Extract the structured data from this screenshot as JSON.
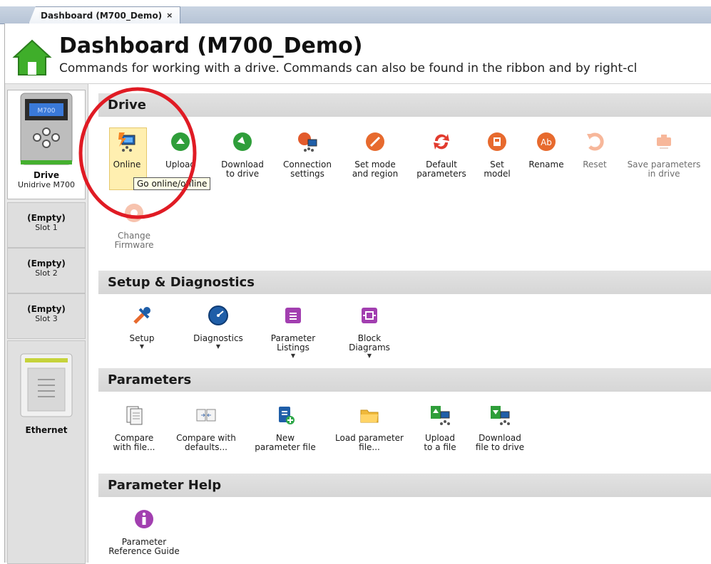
{
  "tab": {
    "label": "Dashboard (M700_Demo)",
    "close": "×"
  },
  "header": {
    "title": "Dashboard (M700_Demo)",
    "subtitle": "Commands for working with a drive. Commands can also be found in the ribbon and by right-cl"
  },
  "rail": {
    "drive": {
      "screen_text": "M700",
      "name": "Drive",
      "model": "Unidrive M700"
    },
    "slots": [
      {
        "title": "(Empty)",
        "subtitle": "Slot 1"
      },
      {
        "title": "(Empty)",
        "subtitle": "Slot 2"
      },
      {
        "title": "(Empty)",
        "subtitle": "Slot 3"
      }
    ],
    "ethernet": {
      "name": "Ethernet"
    }
  },
  "sections": {
    "drive": "Drive",
    "setup": "Setup & Diagnostics",
    "parameters": "Parameters",
    "help": "Parameter Help"
  },
  "drive_cmds": {
    "online": "Online",
    "upload": "Upload",
    "download": "Download\nto drive",
    "connection": "Connection\nsettings",
    "setmode": "Set mode\nand region",
    "default": "Default\nparameters",
    "setmodel": "Set\nmodel",
    "rename": "Rename",
    "reset": "Reset",
    "save": "Save parameters\nin drive",
    "firmware": "Change\nFirmware"
  },
  "tooltip": "Go online/offline",
  "setup_cmds": {
    "setup": "Setup",
    "diagnostics": "Diagnostics",
    "listings": "Parameter\nListings",
    "block": "Block\nDiagrams"
  },
  "param_cmds": {
    "compare_file": "Compare\nwith file...",
    "compare_defaults": "Compare with\ndefaults...",
    "new_file": "New\nparameter file",
    "load_file": "Load parameter\nfile...",
    "upload_file": "Upload\nto a file",
    "download_file": "Download\nfile to drive"
  },
  "help_cmds": {
    "ref_guide": "Parameter\nReference Guide"
  },
  "colors": {
    "annotation": "#e01b24",
    "highlight": "#ffefb0",
    "section_bg": "#d9d9d9"
  }
}
